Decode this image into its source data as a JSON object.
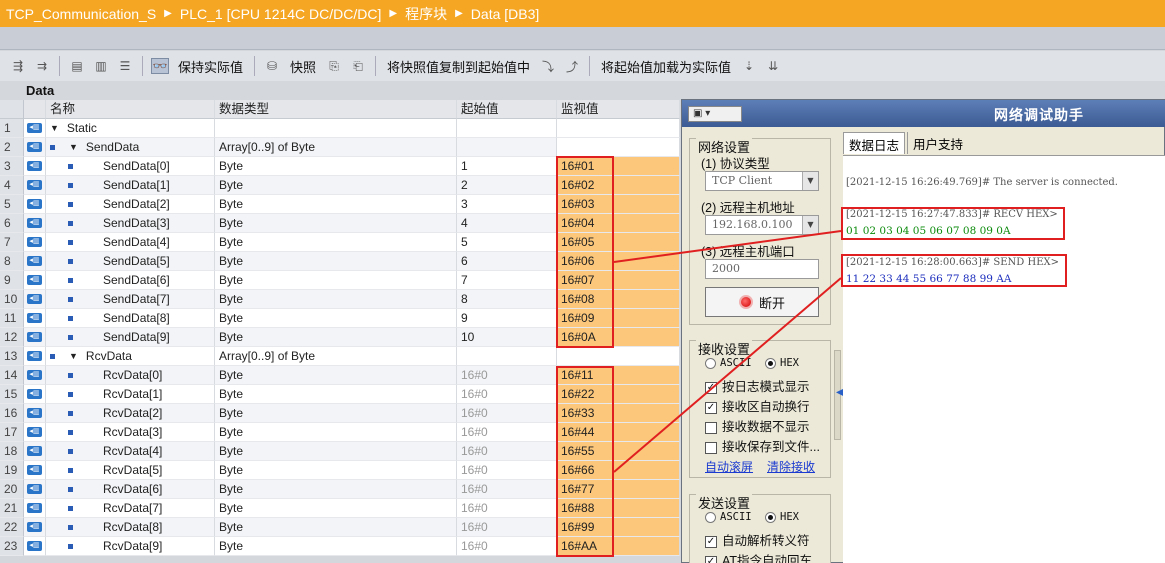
{
  "title_bar": {
    "crumbs": [
      "TCP_Communication_S",
      "PLC_1 [CPU 1214C DC/DC/DC]",
      "程序块",
      "Data [DB3]"
    ]
  },
  "toolbar": {
    "keep_actual": "保持实际值",
    "snapshot": "快照",
    "copy_snapshot": "将快照值复制到起始值中",
    "load_start": "将起始值加载为实际值"
  },
  "block_name": "Data",
  "grid": {
    "headers": {
      "name": "名称",
      "type": "数据类型",
      "start": "起始值",
      "monitor": "监视值"
    },
    "rows": [
      {
        "num": "1",
        "name": "Static",
        "type": "",
        "start": "",
        "monitor": "",
        "level": 0,
        "kind": "section"
      },
      {
        "num": "2",
        "name": "SendData",
        "type": "Array[0..9] of Byte",
        "start": "",
        "monitor": "",
        "level": 1,
        "kind": "array"
      },
      {
        "num": "3",
        "name": "SendData[0]",
        "type": "Byte",
        "start": "1",
        "monitor": "16#01",
        "level": 2,
        "kind": "elem"
      },
      {
        "num": "4",
        "name": "SendData[1]",
        "type": "Byte",
        "start": "2",
        "monitor": "16#02",
        "level": 2,
        "kind": "elem"
      },
      {
        "num": "5",
        "name": "SendData[2]",
        "type": "Byte",
        "start": "3",
        "monitor": "16#03",
        "level": 2,
        "kind": "elem"
      },
      {
        "num": "6",
        "name": "SendData[3]",
        "type": "Byte",
        "start": "4",
        "monitor": "16#04",
        "level": 2,
        "kind": "elem"
      },
      {
        "num": "7",
        "name": "SendData[4]",
        "type": "Byte",
        "start": "5",
        "monitor": "16#05",
        "level": 2,
        "kind": "elem"
      },
      {
        "num": "8",
        "name": "SendData[5]",
        "type": "Byte",
        "start": "6",
        "monitor": "16#06",
        "level": 2,
        "kind": "elem"
      },
      {
        "num": "9",
        "name": "SendData[6]",
        "type": "Byte",
        "start": "7",
        "monitor": "16#07",
        "level": 2,
        "kind": "elem"
      },
      {
        "num": "10",
        "name": "SendData[7]",
        "type": "Byte",
        "start": "8",
        "monitor": "16#08",
        "level": 2,
        "kind": "elem"
      },
      {
        "num": "11",
        "name": "SendData[8]",
        "type": "Byte",
        "start": "9",
        "monitor": "16#09",
        "level": 2,
        "kind": "elem"
      },
      {
        "num": "12",
        "name": "SendData[9]",
        "type": "Byte",
        "start": "10",
        "monitor": "16#0A",
        "level": 2,
        "kind": "elem"
      },
      {
        "num": "13",
        "name": "RcvData",
        "type": "Array[0..9] of Byte",
        "start": "",
        "monitor": "",
        "level": 1,
        "kind": "array"
      },
      {
        "num": "14",
        "name": "RcvData[0]",
        "type": "Byte",
        "start": "16#0",
        "monitor": "16#11",
        "level": 2,
        "kind": "elem"
      },
      {
        "num": "15",
        "name": "RcvData[1]",
        "type": "Byte",
        "start": "16#0",
        "monitor": "16#22",
        "level": 2,
        "kind": "elem"
      },
      {
        "num": "16",
        "name": "RcvData[2]",
        "type": "Byte",
        "start": "16#0",
        "monitor": "16#33",
        "level": 2,
        "kind": "elem"
      },
      {
        "num": "17",
        "name": "RcvData[3]",
        "type": "Byte",
        "start": "16#0",
        "monitor": "16#44",
        "level": 2,
        "kind": "elem"
      },
      {
        "num": "18",
        "name": "RcvData[4]",
        "type": "Byte",
        "start": "16#0",
        "monitor": "16#55",
        "level": 2,
        "kind": "elem"
      },
      {
        "num": "19",
        "name": "RcvData[5]",
        "type": "Byte",
        "start": "16#0",
        "monitor": "16#66",
        "level": 2,
        "kind": "elem"
      },
      {
        "num": "20",
        "name": "RcvData[6]",
        "type": "Byte",
        "start": "16#0",
        "monitor": "16#77",
        "level": 2,
        "kind": "elem"
      },
      {
        "num": "21",
        "name": "RcvData[7]",
        "type": "Byte",
        "start": "16#0",
        "monitor": "16#88",
        "level": 2,
        "kind": "elem"
      },
      {
        "num": "22",
        "name": "RcvData[8]",
        "type": "Byte",
        "start": "16#0",
        "monitor": "16#99",
        "level": 2,
        "kind": "elem"
      },
      {
        "num": "23",
        "name": "RcvData[9]",
        "type": "Byte",
        "start": "16#0",
        "monitor": "16#AA",
        "level": 2,
        "kind": "elem"
      }
    ]
  },
  "assistant": {
    "title": "网络调试助手",
    "net_settings": "网络设置",
    "protocol_label": "(1) 协议类型",
    "protocol_value": "TCP Client",
    "host_label": "(2) 远程主机地址",
    "host_value": "192.168.0.100",
    "port_label": "(3) 远程主机端口",
    "port_value": "2000",
    "disconnect": "断开",
    "recv_settings": "接收设置",
    "ascii": "ASCII",
    "hex": "HEX",
    "log_mode": "按日志模式显示",
    "auto_wrap": "接收区自动换行",
    "no_show": "接收数据不显示",
    "save_file": "接收保存到文件...",
    "auto_scroll": "自动滚屏",
    "clear_recv": "清除接收",
    "send_settings": "发送设置",
    "send_ascii": "ASCII",
    "send_hex": "HEX",
    "auto_escape": "自动解析转义符",
    "at_cmd": "AT指令自动回车",
    "tab_log": "数据日志",
    "tab_support": "用户支持",
    "log1": "[2021-12-15 16:26:49.769]# The server is connected.",
    "log2": "[2021-12-15 16:27:47.833]# RECV HEX>",
    "recv_data": "01 02 03 04 05 06 07 08 09 0A",
    "log3": "[2021-12-15 16:28:00.663]# SEND HEX>",
    "send_data": "11 22 33 44 55 66 77 88 99 AA"
  },
  "colors": {
    "title_bar": "#f5a623",
    "monitor_highlight": "#fcc77a",
    "annotation_red": "#e02020",
    "recv_green": "#0a8a0a",
    "send_blue": "#1c2ebd"
  }
}
